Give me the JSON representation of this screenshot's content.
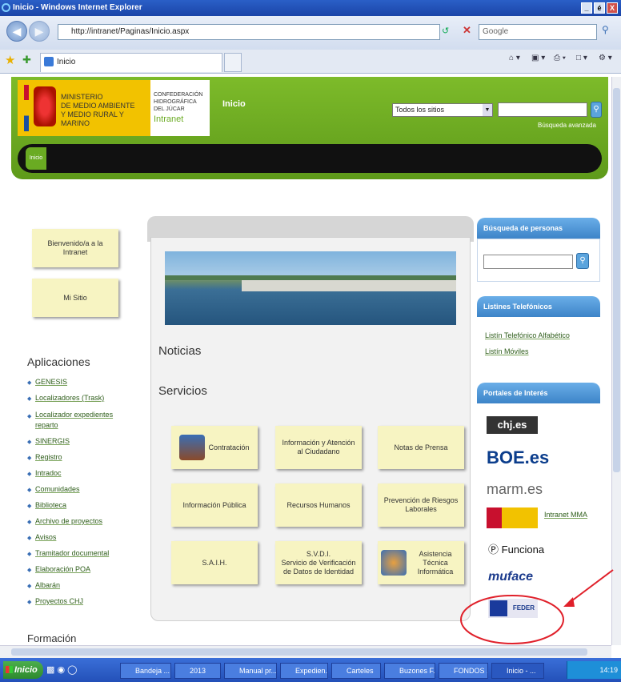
{
  "window": {
    "title": "Inicio - Windows Internet Explorer",
    "controls": [
      "_",
      "é",
      "X"
    ]
  },
  "browser": {
    "address": "http://intranet/Paginas/Inicio.aspx",
    "search_placeholder": "Google",
    "tab_label": "Inicio"
  },
  "header": {
    "ministry": "MINISTERIO\nDE MEDIO AMBIENTE\nY MEDIO RURAL Y MARINO",
    "chj": "CONFEDERACIÓN\nHIDROGRÁFICA\nDEL JÚCAR",
    "intranet": "Intranet",
    "nav_title": "Inicio",
    "site_select": "Todos los sitios",
    "advanced_search": "Búsqueda avanzada",
    "tab_label": "Inicio"
  },
  "left": {
    "welcome": "Bienvenido/a a la Intranet",
    "my_site": "Mi Sitio",
    "apps_title": "Aplicaciones",
    "apps": [
      "GENESIS",
      "Localizadores (Trask)",
      "Localizador expedientes reparto",
      "SINERGIS",
      "Registro",
      "Intradoc",
      "Comunidades",
      "Biblioteca",
      "Archivo de proyectos",
      "Avisos",
      "Tramitador documental",
      "Elaboración POA",
      "Albarán",
      "Proyectos CHJ"
    ],
    "formacion": "Formación"
  },
  "center": {
    "noticias": "Noticias",
    "servicios": "Servicios",
    "services": [
      {
        "label": "Contratación",
        "icon": "house-icon"
      },
      {
        "label": "Información y Atención al Ciudadano"
      },
      {
        "label": "Notas de Prensa"
      },
      {
        "label": "Información Pública"
      },
      {
        "label": "Recursos Humanos"
      },
      {
        "label": "Prevención de Riesgos Laborales"
      },
      {
        "label": "S.A.I.H."
      },
      {
        "label": "S.V.D.I.\nServicio de Verificación de Datos de Identidad"
      },
      {
        "label": "Asistencia Técnica Informática",
        "icon": "support-icon"
      }
    ]
  },
  "right": {
    "people_title": "Búsqueda de personas",
    "phones_title": "Listines Telefónicos",
    "phone_links": [
      "Listín Telefónico Alfabético",
      "Listín Móviles"
    ],
    "portals_title": "Portales de Interés",
    "portals": [
      "chj.es",
      "BOE.es",
      "marm.es",
      "Intranet MMA",
      "Funciona",
      "muface",
      "FEDER"
    ],
    "intranet_mma": "Intranet MMA"
  },
  "taskbar": {
    "start": "Inicio",
    "tasks": [
      "Bandeja ...",
      "2013",
      "Manual pr...",
      "Expedien...",
      "Carteles",
      "Buzones F...",
      "FONDOS ...",
      "Inicio - ..."
    ],
    "clock": "14:19"
  },
  "colors": {
    "green": "#6aab22",
    "annotation": "#e0202a"
  }
}
